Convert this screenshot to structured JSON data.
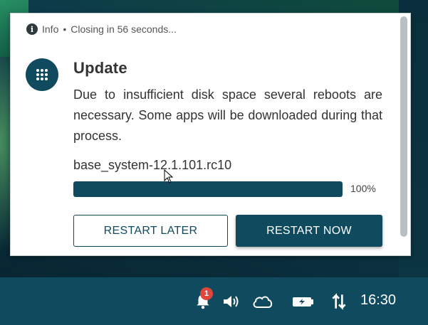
{
  "notification": {
    "info_label": "Info",
    "separator": "•",
    "closing_text": "Closing in 56 seconds...",
    "app_icon": "apps-grid-icon",
    "title": "Update",
    "body": "Due to insufficient disk space several reboots are necessary. Some apps will be downloaded during that process.",
    "file_name": "base_system-12.1.101.rc10",
    "progress_percent": 100,
    "progress_label": "100%",
    "buttons": {
      "later": "RESTART LATER",
      "now": "RESTART NOW"
    }
  },
  "taskbar": {
    "notification_count": "1",
    "icons": [
      "bell-icon",
      "volume-icon",
      "cloud-icon",
      "battery-charging-icon",
      "transfer-arrows-icon"
    ],
    "clock": "16:30"
  },
  "colors": {
    "accent": "#0f4a5e",
    "badge": "#e0453c"
  }
}
